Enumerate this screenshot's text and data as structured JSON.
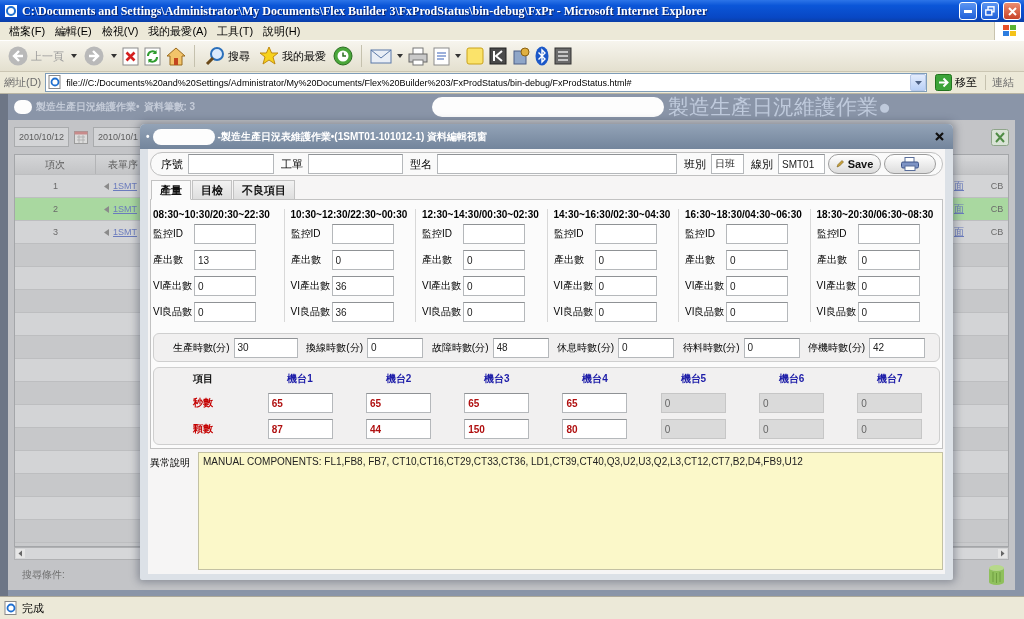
{
  "window": {
    "title": "C:\\Documents and Settings\\Administrator\\My Documents\\Flex Builder 3\\FxProdStatus\\bin-debug\\FxPr - Microsoft Internet Explorer"
  },
  "menu": [
    "檔案(F)",
    "編輯(E)",
    "檢視(V)",
    "我的最愛(A)",
    "工具(T)",
    "說明(H)"
  ],
  "toolbar": {
    "back": {
      "label": "上一頁",
      "disabled": true
    },
    "forward": {
      "disabled": true
    },
    "search": {
      "label": "搜尋"
    },
    "favorites": {
      "label": "我的最愛"
    }
  },
  "address_bar": {
    "label": "網址(D)",
    "url": "file:///C:/Documents%20and%20Settings/Administrator/My%20Documents/Flex%20Builder%203/FxProdStatus/bin-debug/FxProdStatus.html#",
    "go": "移至",
    "links": "連結"
  },
  "app": {
    "title": "製造生產日況維護作業•",
    "count": "資料筆數: 3",
    "banner": "製造生產日況維護作業●",
    "date_from": "2010/10/12",
    "date_to": "2010/10/1",
    "table": {
      "columns": [
        "項次",
        "表單序"
      ],
      "rows": [
        {
          "no": "1",
          "form_no": "1SMT",
          "column_3": "面",
          "column_4": "CB",
          "selected": false
        },
        {
          "no": "2",
          "form_no": "1SMT",
          "column_3": "面",
          "column_4": "CB",
          "selected": true
        },
        {
          "no": "3",
          "form_no": "1SMT",
          "column_3": "面",
          "column_4": "CB",
          "selected": false
        }
      ]
    },
    "search_label": "搜尋條件:"
  },
  "dialog": {
    "bullet": "•",
    "title": "-製造生產日況表維護作業•(1SMT01-101012-1) 資料編輯視窗",
    "fields": [
      {
        "label": "序號"
      },
      {
        "label": "工單"
      },
      {
        "label": "型名"
      },
      {
        "label": "班別",
        "value": "日班"
      },
      {
        "label": "線別",
        "value": "SMT01"
      }
    ],
    "save": "Save",
    "tabs": [
      {
        "label": "產量",
        "selected": true
      },
      {
        "label": "目檢",
        "selected": false
      },
      {
        "label": "不良項目",
        "selected": false
      }
    ],
    "periods": [
      {
        "time": "08:30~10:30/20:30~22:30",
        "fields": [
          {
            "label": "監控ID"
          },
          {
            "label": "產出數",
            "value": "13"
          },
          {
            "label": "VI產出數",
            "value": "0"
          },
          {
            "label": "VI良品數",
            "value": "0"
          }
        ]
      },
      {
        "time": "10:30~12:30/22:30~00:30",
        "fields": [
          {
            "label": "監控ID"
          },
          {
            "label": "產出數",
            "value": "0"
          },
          {
            "label": "VI產出數",
            "value": "36"
          },
          {
            "label": "VI良品數",
            "value": "36"
          }
        ]
      },
      {
        "time": "12:30~14:30/00:30~02:30",
        "fields": [
          {
            "label": "監控ID"
          },
          {
            "label": "產出數",
            "value": "0"
          },
          {
            "label": "VI產出數",
            "value": "0"
          },
          {
            "label": "VI良品數",
            "value": "0"
          }
        ]
      },
      {
        "time": "14:30~16:30/02:30~04:30",
        "fields": [
          {
            "label": "監控ID"
          },
          {
            "label": "產出數",
            "value": "0"
          },
          {
            "label": "VI產出數",
            "value": "0"
          },
          {
            "label": "VI良品數",
            "value": "0"
          }
        ]
      },
      {
        "time": "16:30~18:30/04:30~06:30",
        "fields": [
          {
            "label": "監控ID"
          },
          {
            "label": "產出數",
            "value": "0"
          },
          {
            "label": "VI產出數",
            "value": "0"
          },
          {
            "label": "VI良品數",
            "value": "0"
          }
        ]
      },
      {
        "time": "18:30~20:30/06:30~08:30",
        "fields": [
          {
            "label": "監控ID"
          },
          {
            "label": "產出數",
            "value": "0"
          },
          {
            "label": "VI產出數",
            "value": "0"
          },
          {
            "label": "VI良品數",
            "value": "0"
          }
        ]
      }
    ],
    "hours": [
      {
        "label": "生產時數(分)",
        "value": "30"
      },
      {
        "label": "換線時數(分)",
        "value": "0"
      },
      {
        "label": "故障時數(分)",
        "value": "48"
      },
      {
        "label": "休息時數(分)",
        "value": "0"
      },
      {
        "label": "待料時數(分)",
        "value": "0"
      },
      {
        "label": "停機時數(分)",
        "value": "42"
      }
    ],
    "machines": {
      "corner": "項目",
      "columns": [
        {
          "name": "機台1",
          "disabled": false
        },
        {
          "name": "機台2",
          "disabled": false
        },
        {
          "name": "機台3",
          "disabled": false
        },
        {
          "name": "機台4",
          "disabled": false
        },
        {
          "name": "機台5",
          "disabled": true
        },
        {
          "name": "機台6",
          "disabled": true
        },
        {
          "name": "機台7",
          "disabled": true
        }
      ],
      "rows": [
        {
          "label": "秒數",
          "values": [
            "65",
            "65",
            "65",
            "65",
            "0",
            "0",
            "0"
          ]
        },
        {
          "label": "顆數",
          "values": [
            "87",
            "44",
            "150",
            "80",
            "0",
            "0",
            "0"
          ]
        }
      ]
    },
    "remark": {
      "label": "異常說明",
      "value": "MANUAL COMPONENTS: FL1,FB8, FB7, CT10,CT16,CT29,CT33,CT36, LD1,CT39,CT40,Q3,U2,U3,Q2,L3,CT12,CT7,B2,D4,FB9,U12"
    }
  },
  "status_bar": {
    "text": "完成"
  }
}
